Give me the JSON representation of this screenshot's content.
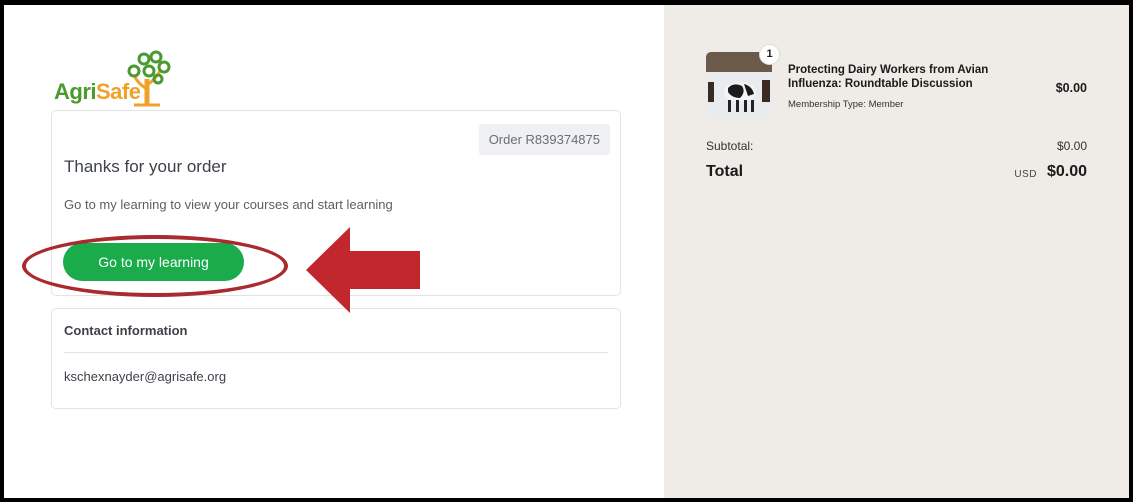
{
  "brand": {
    "logo_part1": "Agri",
    "logo_part2": "Safe"
  },
  "order": {
    "number": "Order R839374875",
    "heading": "Thanks for your order",
    "message": "Go to my learning to view your courses and start learning",
    "button_label": "Go to my learning"
  },
  "contact": {
    "title": "Contact information",
    "email": "kschexnayder@agrisafe.org"
  },
  "summary": {
    "item": {
      "quantity": "1",
      "title": "Protecting Dairy Workers from Avian Influenza: Roundtable Discussion",
      "membership": "Membership Type: Member",
      "price": "$0.00"
    },
    "subtotal_label": "Subtotal:",
    "subtotal_value": "$0.00",
    "total_label": "Total",
    "currency": "USD",
    "total_value": "$0.00"
  },
  "colors": {
    "button": "#1aab4b",
    "highlight": "#a92a2f",
    "summary_bg": "#efebe7"
  }
}
